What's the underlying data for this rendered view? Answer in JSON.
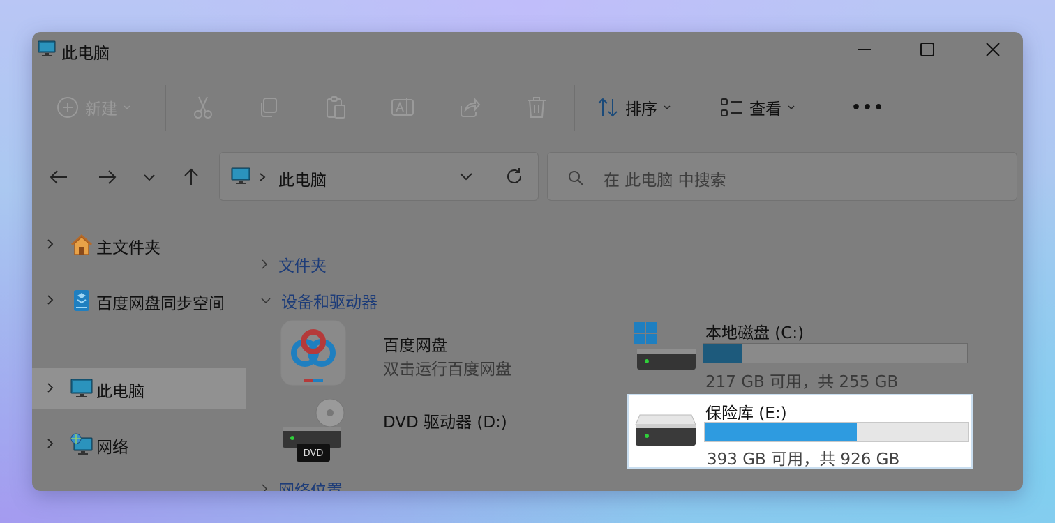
{
  "window": {
    "title": "此电脑"
  },
  "toolbar": {
    "new_label": "新建",
    "sort_label": "排序",
    "view_label": "查看",
    "more_label": "•••",
    "icons": [
      "plus-circle-icon",
      "cut-icon",
      "copy-icon",
      "paste-icon",
      "rename-icon",
      "share-icon",
      "delete-icon",
      "sort-icon",
      "view-icon",
      "more-icon"
    ]
  },
  "address": {
    "current": "此电脑",
    "search_placeholder": "在 此电脑 中搜索"
  },
  "sidebar": {
    "items": [
      {
        "label": "主文件夹",
        "icon": "home-icon",
        "selected": false
      },
      {
        "label": "百度网盘同步空间",
        "icon": "baidu-sync-icon",
        "selected": false
      },
      {
        "label": "此电脑",
        "icon": "monitor-icon",
        "selected": true
      },
      {
        "label": "网络",
        "icon": "network-icon",
        "selected": false
      }
    ]
  },
  "content": {
    "groups": {
      "folders": "文件夹",
      "devices": "设备和驱动器",
      "network": "网络位置"
    },
    "items": {
      "baidu": {
        "name": "百度网盘",
        "subtitle": "双击运行百度网盘"
      },
      "dvd": {
        "name": "DVD 驱动器 (D:)",
        "badge": "DVD"
      },
      "drive_c": {
        "name": "本地磁盘 (C:)",
        "space": "217 GB 可用，共 255 GB",
        "used_fraction": 0.149
      },
      "drive_e": {
        "name": "保险库 (E:)",
        "space": "393 GB 可用，共 926 GB",
        "used_fraction": 0.576
      }
    }
  },
  "colors": {
    "accent": "#2e9be0",
    "window_dim": "#7e7e7e",
    "group_heading": "#1d3c78"
  }
}
